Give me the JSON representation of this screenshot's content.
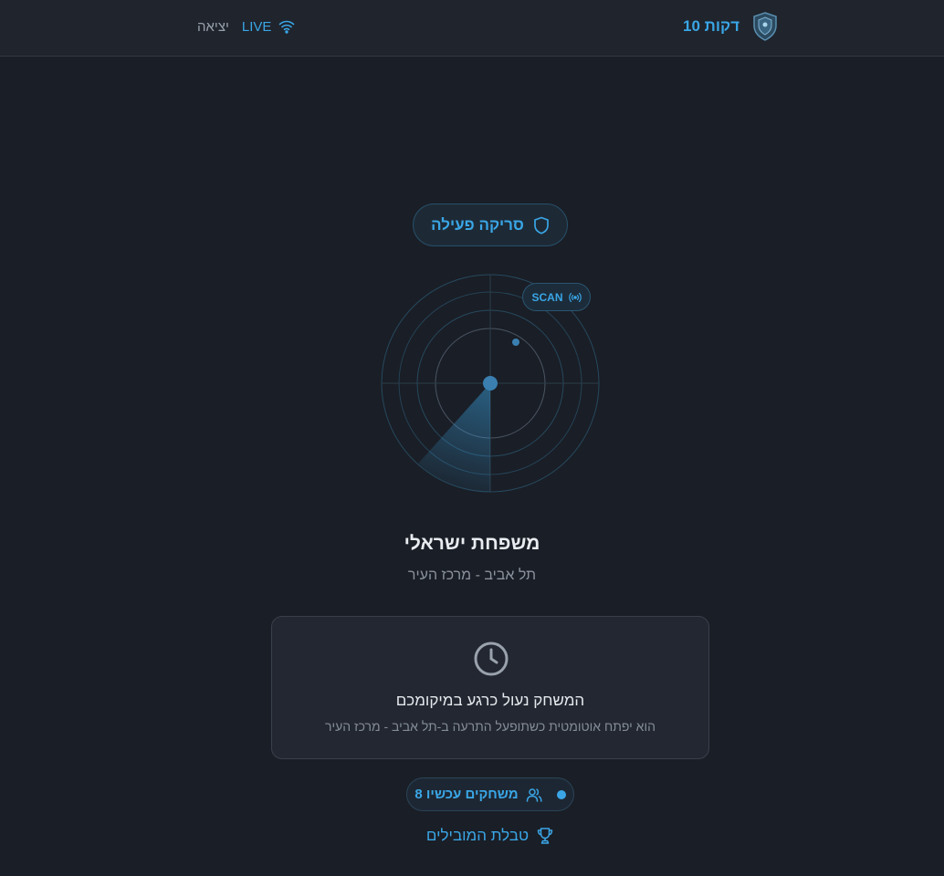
{
  "header": {
    "brand_title": "10 דקות",
    "live_label": "LIVE",
    "exit_label": "יציאה"
  },
  "icons": {
    "brand": "shield-emblem-icon",
    "live": "wifi-icon",
    "scan_pill": "shield-icon",
    "scan_tag": "broadcast-icon",
    "status": "clock-icon",
    "players": "users-icon",
    "leaderboard": "trophy-icon"
  },
  "scan": {
    "pill_label": "סריקה פעילה",
    "tag_label": "SCAN"
  },
  "user": {
    "name": "משפחת ישראלי",
    "location": "תל אביב - מרכז העיר"
  },
  "status_card": {
    "title": "המשחק נעול כרגע במיקומכם",
    "description": "הוא יפתח אוטומטית כשתופעל התרעה ב-תל אביב - מרכז העיר"
  },
  "players": {
    "label": "8 משחקים עכשיו"
  },
  "leaderboard": {
    "label": "טבלת המובילים"
  },
  "colors": {
    "background": "#1a1e26",
    "topbar": "#1f242d",
    "accent": "#3aa6e6",
    "muted_text": "#8a929d"
  }
}
